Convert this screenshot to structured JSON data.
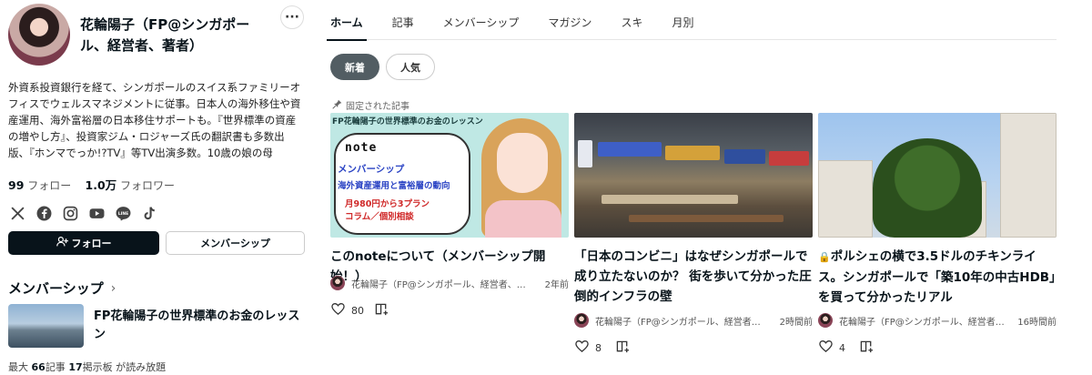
{
  "profile": {
    "name": "花輪陽子（FP@シンガポール、経営者、著者）",
    "more_label": "···",
    "bio": "外資系投資銀行を経て、シンガポールのスイス系ファミリーオフィスでウェルスマネジメントに従事。日本人の海外移住や資産運用、海外富裕層の日本移住サポートも。『世界標準の資産の増やし方』、投資家ジム・ロジャーズ氏の翻訳書も多数出版、『ホンマでっか!?TV』等TV出演多数。10歳の娘の母",
    "follow_count": "99",
    "follow_label": "フォロー",
    "follower_count": "1.0万",
    "follower_label": "フォロワー",
    "social_icons": [
      "x-icon",
      "facebook-icon",
      "instagram-icon",
      "youtube-icon",
      "line-icon",
      "tiktok-icon"
    ],
    "follow_button": "フォロー",
    "membership_button": "メンバーシップ"
  },
  "membership": {
    "heading": "メンバーシップ",
    "chevron": "›",
    "title": "FP花輪陽子の世界標準のお金のレッスン",
    "meta_prefix": "最大",
    "article_count": "66",
    "article_label": "記事",
    "board_count": "17",
    "board_label": "掲示板 が読み放題"
  },
  "tabs": [
    "ホーム",
    "記事",
    "メンバーシップ",
    "マガジン",
    "スキ",
    "月別"
  ],
  "filters": {
    "new": "新着",
    "popular": "人気"
  },
  "pinned_label": "固定された記事",
  "cards": [
    {
      "image_text": {
        "band": "FP花輪陽子の世界標準のお金のレッスン",
        "logo": "note",
        "line1": "メンバーシップ",
        "line2": "海外資産運用と富裕層の動向",
        "line3": "月980円から3プラン",
        "line4": "コラム／個別相談"
      },
      "title": "このnoteについて（メンバーシップ開始！）",
      "author": "花輪陽子（FP@シンガポール、経営者、…",
      "time": "2年前",
      "likes": "80"
    },
    {
      "title": "「日本のコンビニ」はなぜシンガポールで成り立たないのか？ 街を歩いて分かった圧倒的インフラの壁",
      "author": "花輪陽子（FP@シンガポール、経営者…",
      "time": "2時間前",
      "likes": "8"
    },
    {
      "lock": "🔒",
      "title": "ポルシェの横で3.5ドルのチキンライス。シンガポールで「築10年の中古HDB」を買って分かったリアル",
      "author": "花輪陽子（FP@シンガポール、経営者…",
      "time": "16時間前",
      "likes": "4"
    }
  ],
  "colors": {
    "text": "#08131a",
    "accent_dark": "#08131a",
    "pill_active": "#525d63"
  }
}
